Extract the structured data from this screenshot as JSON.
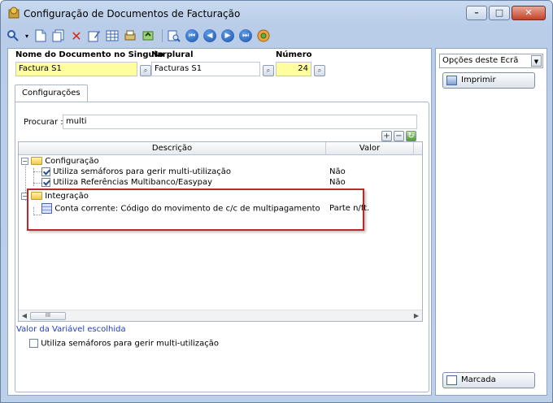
{
  "window": {
    "title": "Configuração de Documentos de Facturação",
    "buttons": [
      "minimize",
      "maximize",
      "close"
    ]
  },
  "toolbar": {
    "icons": [
      "search-icon",
      "new-icon",
      "copy-icon",
      "delete-icon",
      "edit-icon",
      "grid-icon",
      "print-preview-icon",
      "refresh-icon",
      "zoom-icon",
      "first-icon",
      "previous-icon",
      "next-icon",
      "last-icon",
      "help-icon"
    ]
  },
  "header": {
    "singular_label": "Nome do Documento no Singular",
    "singular_value": "Factura S1",
    "plural_label": "No plural",
    "plural_value": "Facturas S1",
    "number_label": "Número",
    "number_value": "24"
  },
  "tabs": [
    {
      "label": "Configurações"
    }
  ],
  "search": {
    "label": "Procurar :",
    "value": "multi"
  },
  "grid": {
    "columns": [
      "Descrição",
      "Valor"
    ],
    "groups": [
      {
        "label": "Configuração",
        "items": [
          {
            "label": "Utiliza semáforos para gerir multi-utilização",
            "value": "Não"
          },
          {
            "label": "Utiliza Referências Multibanco/Easypay",
            "value": "Não"
          }
        ]
      },
      {
        "label": "Integração",
        "items": [
          {
            "label": "Conta corrente: Código do movimento de c/c de multipagamento",
            "value": "Parte n/ft."
          }
        ]
      }
    ],
    "scroll_thumb": "III"
  },
  "footer": {
    "variable_link": "Valor da Variável escolhida",
    "variable_checkbox": "Utiliza semáforos para gerir multi-utilização"
  },
  "side": {
    "options_label": "Opções deste Ecrã",
    "print_label": "Imprimir",
    "marked_label": "Marcada"
  },
  "colors": {
    "highlight_border": "#b92b2b",
    "field_yellow": "#fffe9f",
    "link_blue": "#1f3cc8"
  }
}
